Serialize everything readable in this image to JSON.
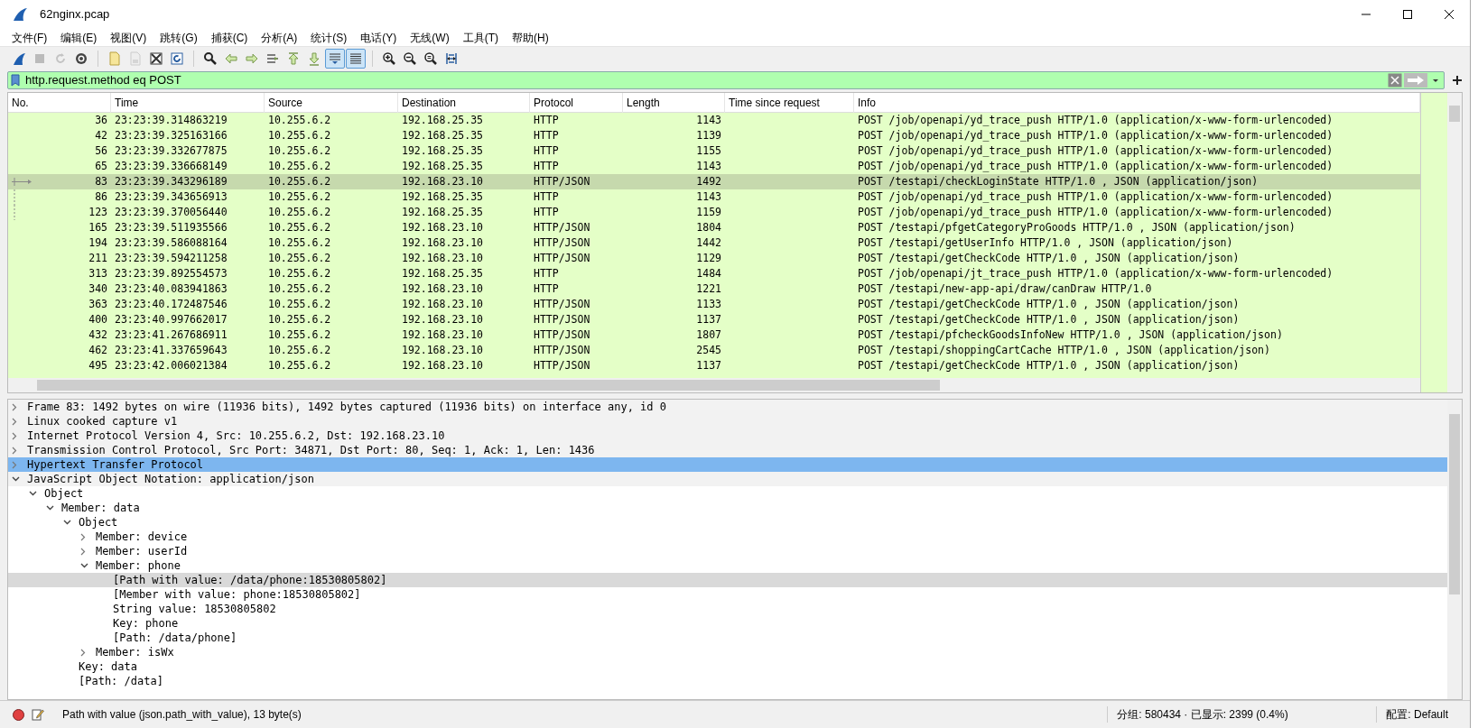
{
  "window": {
    "title": "62nginx.pcap"
  },
  "menu": [
    "文件(F)",
    "编辑(E)",
    "视图(V)",
    "跳转(G)",
    "捕获(C)",
    "分析(A)",
    "统计(S)",
    "电话(Y)",
    "无线(W)",
    "工具(T)",
    "帮助(H)"
  ],
  "toolbar": [
    {
      "pressed": false,
      "disabled": false
    },
    {
      "pressed": false,
      "disabled": true
    },
    {
      "pressed": false,
      "disabled": true
    },
    {
      "pressed": false,
      "disabled": false
    },
    {
      "pressed": false,
      "disabled": false
    },
    {
      "pressed": false,
      "disabled": true
    },
    {
      "pressed": false,
      "disabled": false
    },
    {
      "pressed": false,
      "disabled": false
    },
    {
      "pressed": false,
      "disabled": false
    },
    {
      "pressed": false,
      "disabled": false
    },
    {
      "pressed": false,
      "disabled": false
    },
    {
      "pressed": false,
      "disabled": false
    },
    {
      "pressed": false,
      "disabled": false
    },
    {
      "pressed": false,
      "disabled": false
    },
    {
      "pressed": true,
      "disabled": false
    },
    {
      "pressed": true,
      "disabled": false
    },
    {
      "pressed": false,
      "disabled": false
    },
    {
      "pressed": false,
      "disabled": false
    },
    {
      "pressed": false,
      "disabled": false
    },
    {
      "pressed": false,
      "disabled": false
    }
  ],
  "filter": {
    "value": "http.request.method eq POST",
    "valid": true
  },
  "packet_list": {
    "columns": [
      "No.",
      "Time",
      "Source",
      "Destination",
      "Protocol",
      "Length",
      "Time since request",
      "Info"
    ],
    "rows": [
      {
        "cells": [
          "36",
          "23:23:39.314863219",
          "10.255.6.2",
          "192.168.25.35",
          "HTTP",
          "1143",
          "",
          "POST /job/openapi/yd_trace_push HTTP/1.0  (application/x-www-form-urlencoded)"
        ],
        "selected": false
      },
      {
        "cells": [
          "42",
          "23:23:39.325163166",
          "10.255.6.2",
          "192.168.25.35",
          "HTTP",
          "1139",
          "",
          "POST /job/openapi/yd_trace_push HTTP/1.0  (application/x-www-form-urlencoded)"
        ],
        "selected": false
      },
      {
        "cells": [
          "56",
          "23:23:39.332677875",
          "10.255.6.2",
          "192.168.25.35",
          "HTTP",
          "1155",
          "",
          "POST /job/openapi/yd_trace_push HTTP/1.0  (application/x-www-form-urlencoded)"
        ],
        "selected": false
      },
      {
        "cells": [
          "65",
          "23:23:39.336668149",
          "10.255.6.2",
          "192.168.25.35",
          "HTTP",
          "1143",
          "",
          "POST /job/openapi/yd_trace_push HTTP/1.0  (application/x-www-form-urlencoded)"
        ],
        "selected": false
      },
      {
        "cells": [
          "83",
          "23:23:39.343296189",
          "10.255.6.2",
          "192.168.23.10",
          "HTTP/JSON",
          "1492",
          "",
          "POST /testapi/checkLoginState HTTP/1.0 , JSON (application/json)"
        ],
        "selected": true,
        "kind": "current"
      },
      {
        "cells": [
          "86",
          "23:23:39.343656913",
          "10.255.6.2",
          "192.168.25.35",
          "HTTP",
          "1143",
          "",
          "POST /job/openapi/yd_trace_push HTTP/1.0  (application/x-www-form-urlencoded)"
        ],
        "selected": false,
        "kind": "related"
      },
      {
        "cells": [
          "123",
          "23:23:39.370056440",
          "10.255.6.2",
          "192.168.25.35",
          "HTTP",
          "1159",
          "",
          "POST /job/openapi/yd_trace_push HTTP/1.0  (application/x-www-form-urlencoded)"
        ],
        "selected": false,
        "kind": "related"
      },
      {
        "cells": [
          "165",
          "23:23:39.511935566",
          "10.255.6.2",
          "192.168.23.10",
          "HTTP/JSON",
          "1804",
          "",
          "POST /testapi/pfgetCategoryProGoods HTTP/1.0 , JSON (application/json)"
        ],
        "selected": false
      },
      {
        "cells": [
          "194",
          "23:23:39.586088164",
          "10.255.6.2",
          "192.168.23.10",
          "HTTP/JSON",
          "1442",
          "",
          "POST /testapi/getUserInfo HTTP/1.0 , JSON (application/json)"
        ],
        "selected": false
      },
      {
        "cells": [
          "211",
          "23:23:39.594211258",
          "10.255.6.2",
          "192.168.23.10",
          "HTTP/JSON",
          "1129",
          "",
          "POST /testapi/getCheckCode HTTP/1.0 , JSON (application/json)"
        ],
        "selected": false
      },
      {
        "cells": [
          "313",
          "23:23:39.892554573",
          "10.255.6.2",
          "192.168.25.35",
          "HTTP",
          "1484",
          "",
          "POST /job/openapi/jt_trace_push HTTP/1.0  (application/x-www-form-urlencoded)"
        ],
        "selected": false
      },
      {
        "cells": [
          "340",
          "23:23:40.083941863",
          "10.255.6.2",
          "192.168.23.10",
          "HTTP",
          "1221",
          "",
          "POST /testapi/new-app-api/draw/canDraw HTTP/1.0"
        ],
        "selected": false
      },
      {
        "cells": [
          "363",
          "23:23:40.172487546",
          "10.255.6.2",
          "192.168.23.10",
          "HTTP/JSON",
          "1133",
          "",
          "POST /testapi/getCheckCode HTTP/1.0 , JSON (application/json)"
        ],
        "selected": false
      },
      {
        "cells": [
          "400",
          "23:23:40.997662017",
          "10.255.6.2",
          "192.168.23.10",
          "HTTP/JSON",
          "1137",
          "",
          "POST /testapi/getCheckCode HTTP/1.0 , JSON (application/json)"
        ],
        "selected": false
      },
      {
        "cells": [
          "432",
          "23:23:41.267686911",
          "10.255.6.2",
          "192.168.23.10",
          "HTTP/JSON",
          "1807",
          "",
          "POST /testapi/pfcheckGoodsInfoNew HTTP/1.0 , JSON (application/json)"
        ],
        "selected": false
      },
      {
        "cells": [
          "462",
          "23:23:41.337659643",
          "10.255.6.2",
          "192.168.23.10",
          "HTTP/JSON",
          "2545",
          "",
          "POST /testapi/shoppingCartCache HTTP/1.0 , JSON (application/json)"
        ],
        "selected": false
      },
      {
        "cells": [
          "495",
          "23:23:42.006021384",
          "10.255.6.2",
          "192.168.23.10",
          "HTTP/JSON",
          "1137",
          "",
          "POST /testapi/getCheckCode HTTP/1.0 , JSON (application/json)"
        ],
        "selected": false
      }
    ]
  },
  "details": [
    {
      "text": "Frame 83: 1492 bytes on wire (11936 bits), 1492 bytes captured (11936 bits) on interface any, id 0",
      "expanded": false,
      "selected": false,
      "highlighted": false
    },
    {
      "text": "Linux cooked capture v1",
      "expanded": false,
      "selected": false,
      "highlighted": false
    },
    {
      "text": "Internet Protocol Version 4, Src: 10.255.6.2, Dst: 192.168.23.10",
      "expanded": false,
      "selected": false,
      "highlighted": false
    },
    {
      "text": "Transmission Control Protocol, Src Port: 34871, Dst Port: 80, Seq: 1, Ack: 1, Len: 1436",
      "expanded": false,
      "selected": false,
      "highlighted": false
    },
    {
      "text": "Hypertext Transfer Protocol",
      "expanded": false,
      "selected": true,
      "highlighted": false
    },
    {
      "text": "JavaScript Object Notation: application/json",
      "expanded": true,
      "selected": false,
      "highlighted": false,
      "children": [
        {
          "text": "Object",
          "expanded": true,
          "selected": false,
          "highlighted": false,
          "children": [
            {
              "text": "Member: data",
              "expanded": true,
              "selected": false,
              "highlighted": false,
              "children": [
                {
                  "text": "Object",
                  "expanded": true,
                  "selected": false,
                  "highlighted": false,
                  "children": [
                    {
                      "text": "Member: device",
                      "expanded": false,
                      "selected": false,
                      "highlighted": false
                    },
                    {
                      "text": "Member: userId",
                      "expanded": false,
                      "selected": false,
                      "highlighted": false
                    },
                    {
                      "text": "Member: phone",
                      "expanded": true,
                      "selected": false,
                      "highlighted": false,
                      "children": [
                        {
                          "text": "[Path with value: /data/phone:18530805802]",
                          "selected": false,
                          "highlighted": true
                        },
                        {
                          "text": "[Member with value: phone:18530805802]",
                          "selected": false,
                          "highlighted": false
                        },
                        {
                          "text": "String value: 18530805802",
                          "selected": false,
                          "highlighted": false
                        },
                        {
                          "text": "Key: phone",
                          "selected": false,
                          "highlighted": false
                        },
                        {
                          "text": "[Path: /data/phone]",
                          "selected": false,
                          "highlighted": false
                        }
                      ]
                    },
                    {
                      "text": "Member: isWx",
                      "expanded": false,
                      "selected": false,
                      "highlighted": false
                    }
                  ]
                },
                {
                  "text": "Key: data",
                  "selected": false,
                  "highlighted": false
                },
                {
                  "text": "[Path: /data]",
                  "selected": false,
                  "highlighted": false
                }
              ]
            }
          ]
        }
      ]
    }
  ],
  "status_bar": {
    "recording": false,
    "field_info": "Path with value (json.path_with_value), 13 byte(s)",
    "packets": "分组: 580434 · 已显示: 2399 (0.4%)",
    "profile": "配置: Default"
  }
}
